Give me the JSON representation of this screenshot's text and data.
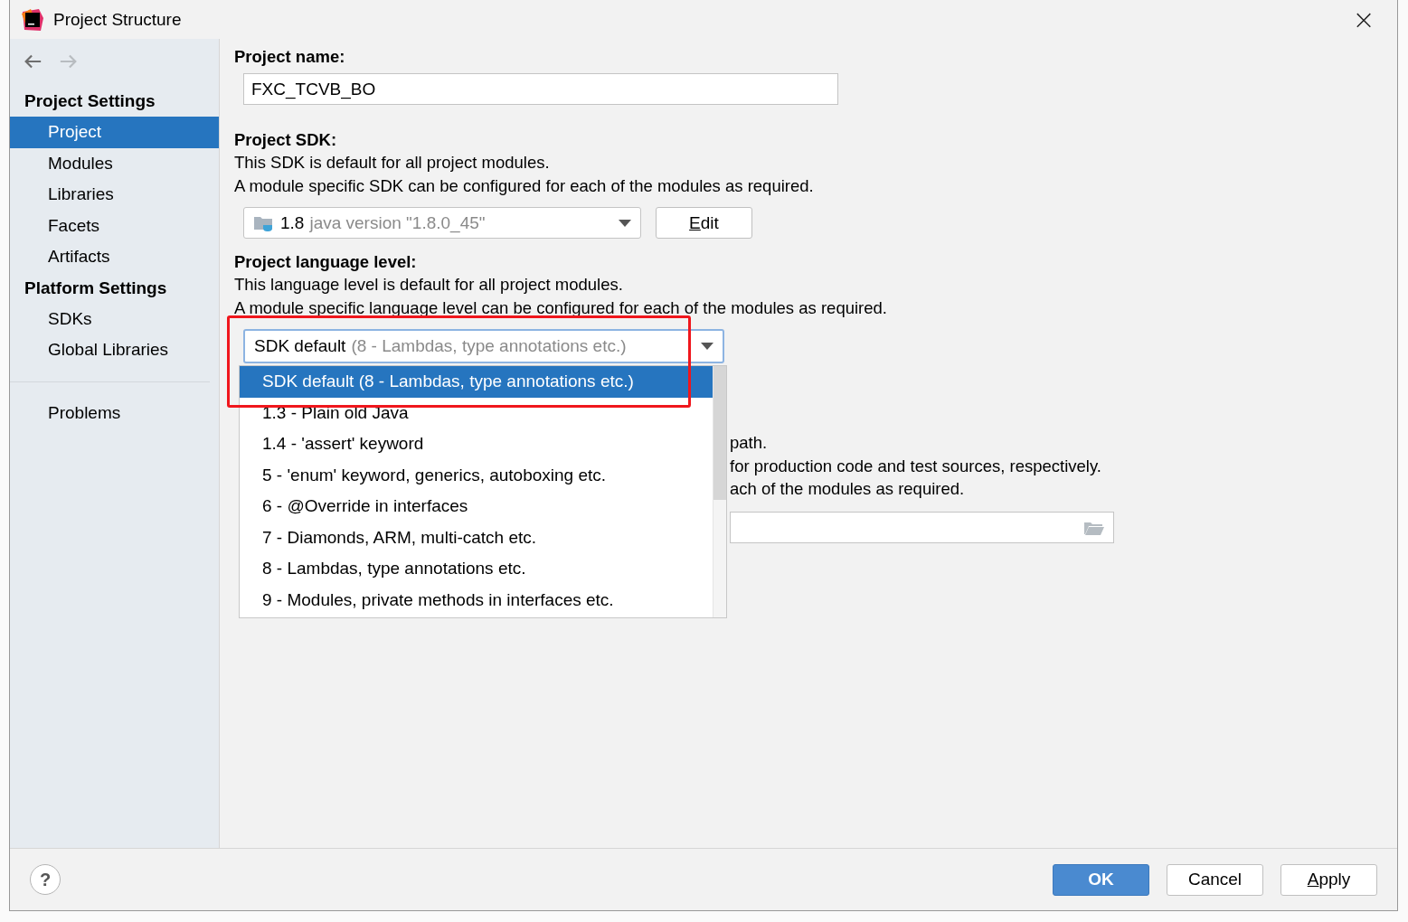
{
  "window": {
    "title": "Project Structure",
    "close": "×"
  },
  "sidebar": {
    "nav": [
      {
        "kind": "back",
        "disabled": false
      },
      {
        "kind": "forward",
        "disabled": true
      }
    ],
    "groups": [
      {
        "title": "Project Settings",
        "items": [
          {
            "label": "Project",
            "selected": true
          },
          {
            "label": "Modules",
            "selected": false
          },
          {
            "label": "Libraries",
            "selected": false
          },
          {
            "label": "Facets",
            "selected": false
          },
          {
            "label": "Artifacts",
            "selected": false
          }
        ]
      },
      {
        "title": "Platform Settings",
        "items": [
          {
            "label": "SDKs",
            "selected": false
          },
          {
            "label": "Global Libraries",
            "selected": false
          }
        ]
      }
    ],
    "extra_items": [
      {
        "label": "Problems",
        "selected": false
      }
    ]
  },
  "project_name": {
    "label": "Project name:",
    "value": "FXC_TCVB_BO"
  },
  "project_sdk": {
    "label": "Project SDK:",
    "description": [
      "This SDK is default for all project modules.",
      "A module specific SDK can be configured for each of the modules as required."
    ],
    "combo": {
      "version": "1.8",
      "detail": "java version \"1.8.0_45\""
    },
    "edit_button": {
      "label": "Edit",
      "underline_first": true
    }
  },
  "language_level": {
    "label": "Project language level:",
    "description": [
      "This language level is default for all project modules.",
      "A module specific language level can be configured for each of the modules as required."
    ],
    "combo": {
      "value": "SDK default",
      "detail": "(8 - Lambdas, type annotations etc.)",
      "focused": true
    },
    "highlighted": true,
    "options": [
      {
        "label": "SDK default (8 - Lambdas, type annotations etc.)",
        "selected": true
      },
      {
        "label": "1.3 - Plain old Java",
        "selected": false
      },
      {
        "label": "1.4 - 'assert' keyword",
        "selected": false
      },
      {
        "label": "5 - 'enum' keyword, generics, autoboxing etc.",
        "selected": false
      },
      {
        "label": "6 - @Override in interfaces",
        "selected": false
      },
      {
        "label": "7 - Diamonds, ARM, multi-catch etc.",
        "selected": false
      },
      {
        "label": "8 - Lambdas, type annotations etc.",
        "selected": false
      },
      {
        "label": "9 - Modules, private methods in interfaces etc.",
        "selected": false
      }
    ]
  },
  "compiler_output": {
    "lines": [
      "path.",
      "for production code and test sources, respectively.",
      "ach of the modules as required."
    ]
  },
  "footer": {
    "help": "?",
    "buttons": [
      {
        "label": "OK",
        "kind": "primary",
        "underline_first": false
      },
      {
        "label": "Cancel",
        "kind": "normal",
        "underline_first": false
      },
      {
        "label": "Apply",
        "kind": "normal",
        "underline_first": true
      }
    ]
  }
}
